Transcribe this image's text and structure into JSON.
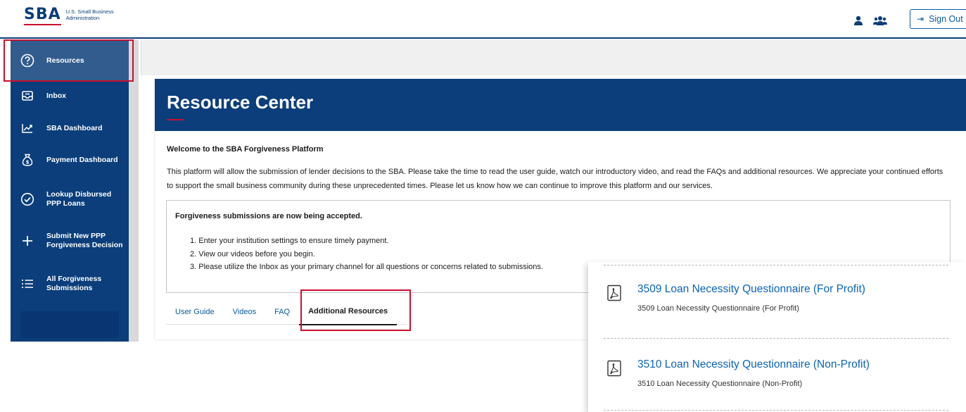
{
  "header": {
    "logo_mark": "SBA",
    "logo_line1": "U.S. Small Business",
    "logo_line2": "Administration",
    "signout_label": "Sign Out",
    "icons": [
      "user-icon",
      "users-icon",
      "sign-out-icon"
    ]
  },
  "sidebar": {
    "items": [
      {
        "label": "Resources",
        "icon": "help-circle-icon"
      },
      {
        "label": "Inbox",
        "icon": "inbox-icon"
      },
      {
        "label": "SBA Dashboard",
        "icon": "chart-trend-icon"
      },
      {
        "label": "Payment Dashboard",
        "icon": "money-bag-icon"
      },
      {
        "label": "Lookup Disbursed PPP Loans",
        "icon": "check-circle-icon"
      },
      {
        "label": "Submit New PPP Forgiveness Decision",
        "icon": "plus-icon"
      },
      {
        "label": "All Forgiveness Submissions",
        "icon": "list-icon"
      }
    ]
  },
  "page": {
    "title": "Resource Center",
    "welcome_title": "Welcome to the SBA Forgiveness Platform",
    "welcome_text": "This platform will allow the submission of lender decisions to the SBA. Please take the time to read the user guide, watch our introductory video, and read the FAQs and additional resources. We appreciate your continued efforts to support the small business community during these unprecedented times. Please let us know how we can continue to improve this platform and our services.",
    "notice_title": "Forgiveness submissions are now being accepted.",
    "notice_items": [
      "1. Enter your institution settings to ensure timely payment.",
      "2. View our videos before you begin.",
      "3. Please utilize the Inbox as your primary channel for all questions or concerns related to submissions."
    ],
    "tabs": [
      "User Guide",
      "Videos",
      "FAQ",
      "Additional Resources"
    ],
    "active_tab": "Additional Resources"
  },
  "resources": [
    {
      "title": "3509 Loan Necessity Questionnaire (For Profit)",
      "description": "3509 Loan Necessity Questionnaire (For Profit)",
      "icon": "pdf-icon"
    },
    {
      "title": "3510 Loan Necessity Questionnaire (Non-Profit)",
      "description": "3510 Loan Necessity Questionnaire (Non-Profit)",
      "icon": "pdf-icon"
    }
  ],
  "colors": {
    "navy": "#0b3e7a",
    "link_blue": "#0b64b5",
    "highlight_red": "#c8102e"
  }
}
